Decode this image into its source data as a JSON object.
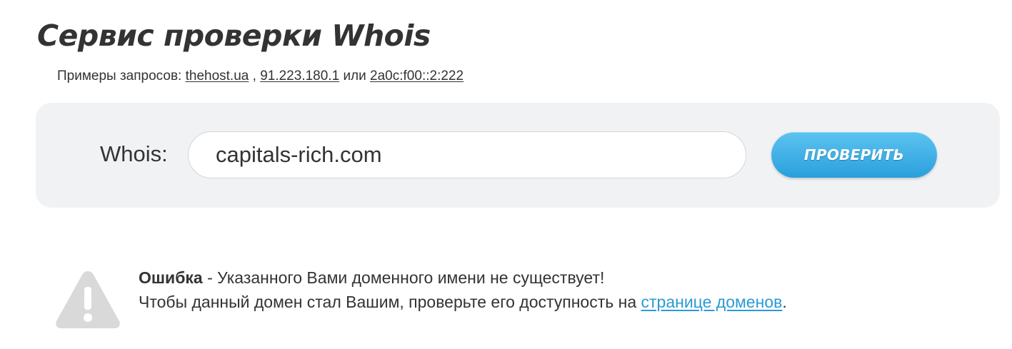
{
  "page": {
    "title": "Сервис проверки Whois"
  },
  "examples": {
    "prefix": "Примеры запросов:",
    "links": [
      "thehost.ua",
      "91.223.180.1",
      "2a0c:f00::2:222"
    ],
    "separator_comma": ",",
    "separator_or": "или"
  },
  "search": {
    "label": "Whois:",
    "value": "capitals-rich.com",
    "button_label": "ПРОВЕРИТЬ",
    "button_color": "#2a9fdd"
  },
  "error": {
    "icon": "warning-icon",
    "title": "Ошибка",
    "message": " - Указанного Вами доменного имени не существует!",
    "hint_prefix": "Чтобы данный домен стал Вашим, проверьте его доступность на ",
    "hint_link": "странице доменов",
    "hint_suffix": ".",
    "link_color": "#2a9ad6"
  }
}
